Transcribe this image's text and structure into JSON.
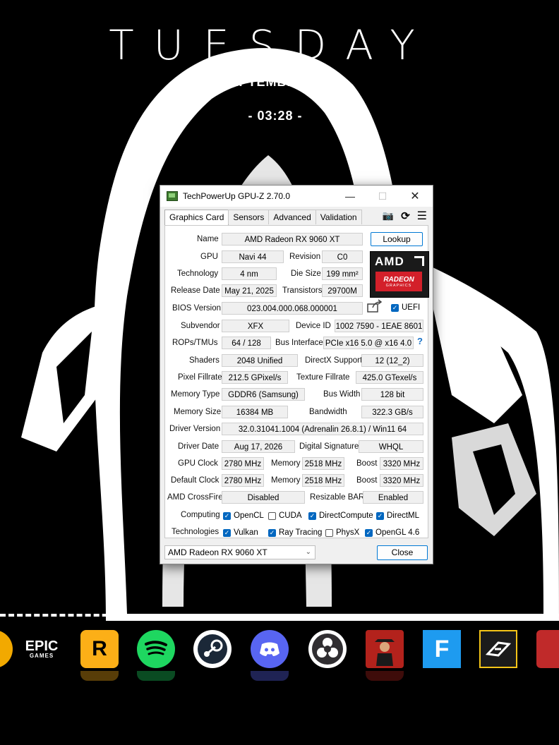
{
  "wallpaper": {
    "day": "TUESDAY",
    "date": "01 SEPTEMBER, 2026.",
    "time": "- 03:28 -"
  },
  "window": {
    "title": "TechPowerUp GPU-Z 2.70.0",
    "tabs": [
      "Graphics Card",
      "Sensors",
      "Advanced",
      "Validation"
    ],
    "active_tab": "Graphics Card"
  },
  "fields": {
    "name": {
      "label": "Name",
      "value": "AMD Radeon RX 9060 XT"
    },
    "lookup_label": "Lookup",
    "gpu": {
      "label": "GPU",
      "value": "Navi 44"
    },
    "revision": {
      "label": "Revision",
      "value": "C0"
    },
    "technology": {
      "label": "Technology",
      "value": "4 nm"
    },
    "die_size": {
      "label": "Die Size",
      "value": "199 mm²"
    },
    "release_date": {
      "label": "Release Date",
      "value": "May 21, 2025"
    },
    "transistors": {
      "label": "Transistors",
      "value": "29700M"
    },
    "bios_version": {
      "label": "BIOS Version",
      "value": "023.004.000.068.000001"
    },
    "uefi": {
      "label": "UEFI",
      "checked": true
    },
    "subvendor": {
      "label": "Subvendor",
      "value": "XFX"
    },
    "device_id": {
      "label": "Device ID",
      "value": "1002 7590 - 1EAE 8601"
    },
    "rops_tmus": {
      "label": "ROPs/TMUs",
      "value": "64 / 128"
    },
    "bus_interface": {
      "label": "Bus Interface",
      "value": "PCIe x16 5.0 @ x16 4.0"
    },
    "shaders": {
      "label": "Shaders",
      "value": "2048 Unified"
    },
    "directx": {
      "label": "DirectX Support",
      "value": "12 (12_2)"
    },
    "pixel_fillrate": {
      "label": "Pixel Fillrate",
      "value": "212.5 GPixel/s"
    },
    "texture_fillrate": {
      "label": "Texture Fillrate",
      "value": "425.0 GTexel/s"
    },
    "memory_type": {
      "label": "Memory Type",
      "value": "GDDR6 (Samsung)"
    },
    "bus_width": {
      "label": "Bus Width",
      "value": "128 bit"
    },
    "memory_size": {
      "label": "Memory Size",
      "value": "16384 MB"
    },
    "bandwidth": {
      "label": "Bandwidth",
      "value": "322.3 GB/s"
    },
    "driver_version": {
      "label": "Driver Version",
      "value": "32.0.31041.1004 (Adrenalin 26.8.1) / Win11 64"
    },
    "driver_date": {
      "label": "Driver Date",
      "value": "Aug 17, 2026"
    },
    "digital_signature": {
      "label": "Digital Signature",
      "value": "WHQL"
    },
    "gpu_clock": {
      "label": "GPU Clock",
      "value": "2780 MHz",
      "memory_label": "Memory",
      "memory": "2518 MHz",
      "boost_label": "Boost",
      "boost": "3320 MHz"
    },
    "default_clock": {
      "label": "Default Clock",
      "value": "2780 MHz",
      "memory_label": "Memory",
      "memory": "2518 MHz",
      "boost_label": "Boost",
      "boost": "3320 MHz"
    },
    "crossfire": {
      "label": "AMD CrossFire",
      "value": "Disabled"
    },
    "resizable_bar": {
      "label": "Resizable BAR",
      "value": "Enabled"
    }
  },
  "computing": {
    "label": "Computing",
    "items": [
      {
        "label": "OpenCL",
        "checked": true
      },
      {
        "label": "CUDA",
        "checked": false
      },
      {
        "label": "DirectCompute",
        "checked": true
      },
      {
        "label": "DirectML",
        "checked": true
      }
    ]
  },
  "technologies": {
    "label": "Technologies",
    "items": [
      {
        "label": "Vulkan",
        "checked": true
      },
      {
        "label": "Ray Tracing",
        "checked": true
      },
      {
        "label": "PhysX",
        "checked": false
      },
      {
        "label": "OpenGL 4.6",
        "checked": true
      }
    ]
  },
  "logo": {
    "brand": "AMD",
    "line": "RADEON",
    "sub": "GRAPHICS"
  },
  "bottom": {
    "selected_gpu": "AMD Radeon RX 9060 XT",
    "close_label": "Close"
  },
  "dock": {
    "epic": {
      "line1": "EPIC",
      "line2": "GAMES"
    },
    "rockstar": "R",
    "fortnite": "F"
  },
  "colors": {
    "accent": "#0067c0",
    "amd_red": "#d3202a",
    "spotify": "#1ed760",
    "discord": "#5865f2",
    "steam": "#1b2838"
  }
}
